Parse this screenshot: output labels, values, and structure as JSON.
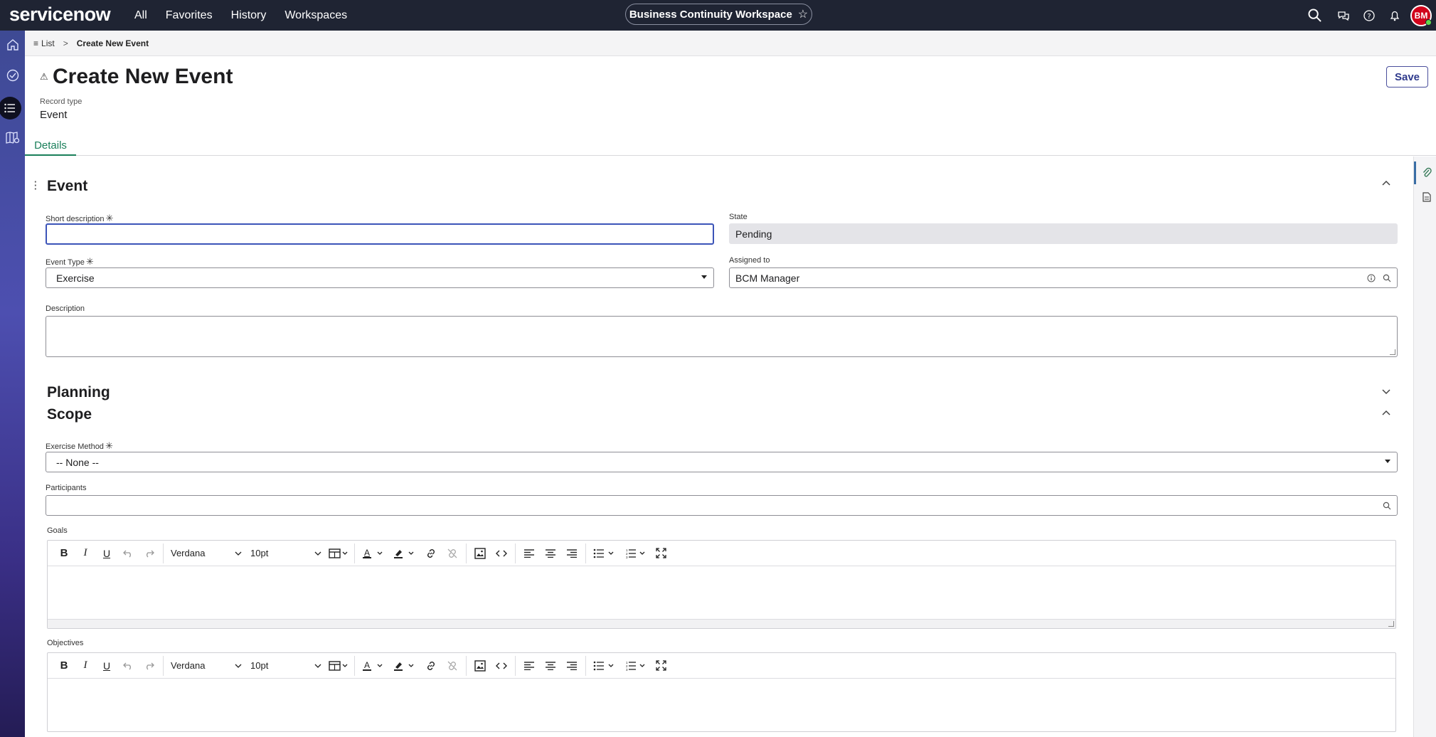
{
  "topbar": {
    "logo_service": "servicen",
    "logo_now": "ow",
    "nav": [
      "All",
      "Favorites",
      "History",
      "Workspaces"
    ],
    "workspace_title": "Business Continuity Workspace",
    "workspace_star": "☆",
    "avatar_initials": "BM"
  },
  "breadcrumb": {
    "list_icon": "≡",
    "list_label": "List",
    "separator": ">",
    "current": "Create New Event"
  },
  "header": {
    "title_icon": "⚠",
    "title": "Create New Event",
    "record_type_label": "Record type",
    "record_type_value": "Event",
    "save_label": "Save",
    "tab_details": "Details"
  },
  "event_section": {
    "title": "Event",
    "short_description_label": "Short description",
    "short_description_value": "",
    "state_label": "State",
    "state_value": "Pending",
    "event_type_label": "Event Type",
    "event_type_value": "Exercise",
    "assigned_to_label": "Assigned to",
    "assigned_to_value": "BCM Manager",
    "description_label": "Description"
  },
  "planning_section": {
    "title": "Planning"
  },
  "scope_section": {
    "title": "Scope",
    "exercise_method_label": "Exercise Method",
    "exercise_method_value": "-- None --",
    "participants_label": "Participants",
    "goals_label": "Goals",
    "objectives_label": "Objectives"
  },
  "editor": {
    "font_family": "Verdana",
    "font_size": "10pt"
  },
  "required_mark": "✳",
  "colors": {
    "topbar": "#1f2433",
    "accent_green": "#1a7f5a",
    "focus_blue": "#3c54b8",
    "save_text": "#2f3a8c"
  }
}
